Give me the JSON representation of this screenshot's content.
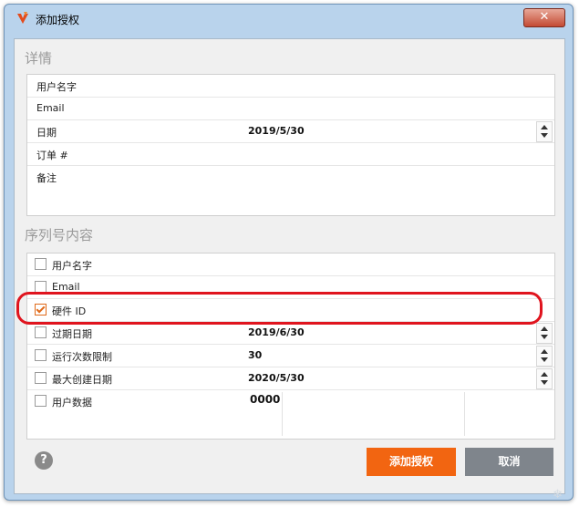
{
  "window": {
    "title": "添加授权",
    "close_label": "✕"
  },
  "details": {
    "section_title": "详情",
    "rows": [
      {
        "label": "用户名字",
        "value": ""
      },
      {
        "label": "Email",
        "value": ""
      },
      {
        "label": "日期",
        "value": "2019/5/30"
      },
      {
        "label": "订单 #",
        "value": ""
      },
      {
        "label": "备注",
        "value": ""
      }
    ]
  },
  "serial": {
    "section_title": "序列号内容",
    "rows": [
      {
        "label": "用户名字",
        "checked": false,
        "value": ""
      },
      {
        "label": "Email",
        "checked": false,
        "value": ""
      },
      {
        "label": "硬件 ID",
        "checked": true,
        "value": ""
      },
      {
        "label": "过期日期",
        "checked": false,
        "value": "2019/6/30"
      },
      {
        "label": "运行次数限制",
        "checked": false,
        "value": "30"
      },
      {
        "label": "最大创建日期",
        "checked": false,
        "value": "2020/5/30"
      },
      {
        "label": "用户数据",
        "checked": false,
        "value": "0000"
      }
    ]
  },
  "footer": {
    "help_label": "?",
    "add_label": "添加授权",
    "cancel_label": "取消"
  },
  "colors": {
    "accent": "#f26511",
    "annotation": "#e0141e",
    "cancel": "#7f858c"
  }
}
